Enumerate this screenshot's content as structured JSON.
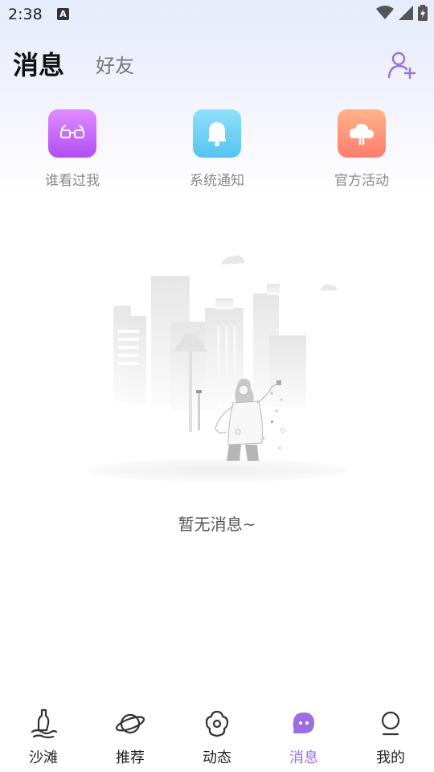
{
  "status_bar": {
    "time": "2:38",
    "notification_icon": "A",
    "icons": [
      "wifi-icon",
      "signal-icon",
      "battery-charging-icon"
    ]
  },
  "header": {
    "tabs": [
      {
        "label": "消息",
        "active": true
      },
      {
        "label": "好友",
        "active": false
      }
    ],
    "action_icon": "add-friend-icon"
  },
  "quick_entries": [
    {
      "label": "谁看过我",
      "icon": "glasses-icon",
      "color": "#c56af9"
    },
    {
      "label": "系统通知",
      "icon": "bell-icon",
      "color": "#6dcef3"
    },
    {
      "label": "官方活动",
      "icon": "cloud-icon",
      "color": "#ff907a"
    }
  ],
  "empty_state": {
    "text": "暂无消息~",
    "illustration": "city-girl-illustration"
  },
  "bottom_nav": {
    "items": [
      {
        "label": "沙滩",
        "icon": "bottle-icon",
        "active": false
      },
      {
        "label": "推荐",
        "icon": "planet-icon",
        "active": false
      },
      {
        "label": "动态",
        "icon": "flower-icon",
        "active": false
      },
      {
        "label": "消息",
        "icon": "chat-bubble-icon",
        "active": true
      },
      {
        "label": "我的",
        "icon": "profile-icon",
        "active": false
      }
    ],
    "active_color": "#9b6fe0"
  }
}
